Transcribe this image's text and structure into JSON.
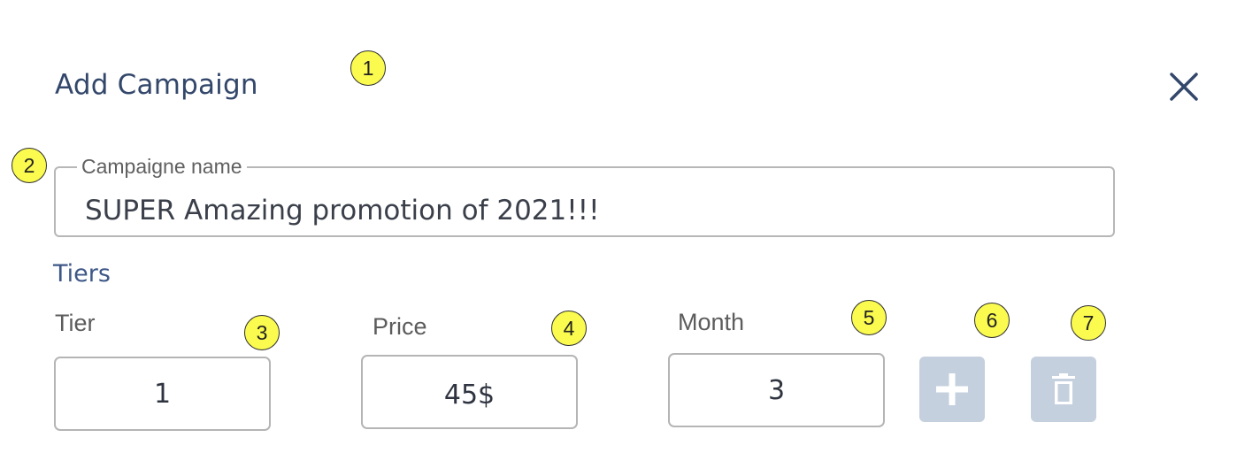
{
  "dialog": {
    "title": "Add Campaign",
    "close_icon": "close-icon"
  },
  "campaign_name": {
    "label": "Campaigne name",
    "value": "SUPER Amazing promotion of 2021!!!"
  },
  "tiers": {
    "section_title": "Tiers",
    "columns": {
      "tier_label": "Tier",
      "price_label": "Price",
      "month_label": "Month"
    },
    "row": {
      "tier": "1",
      "price": "45$",
      "month": "3"
    },
    "add_icon": "plus-icon",
    "delete_icon": "trash-icon",
    "button_color": "#c5d0de"
  },
  "markers": [
    "1",
    "2",
    "3",
    "4",
    "5",
    "6",
    "7"
  ],
  "colors": {
    "title": "#33476b",
    "section": "#3d5787",
    "marker": "#fafa4f"
  }
}
